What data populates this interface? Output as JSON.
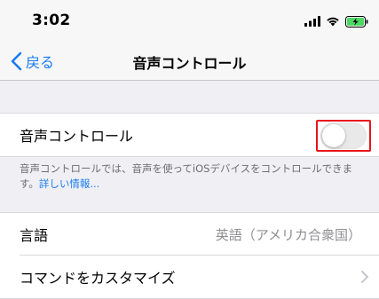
{
  "status": {
    "time": "3:02"
  },
  "nav": {
    "back_label": "戻る",
    "title": "音声コントロール"
  },
  "voice_control": {
    "label": "音声コントロール",
    "toggle_on": false,
    "footer_text": "音声コントロールでは、音声を使ってiOSデバイスをコントロールできます。",
    "footer_link": "詳しい情報..."
  },
  "settings": {
    "language_label": "言語",
    "language_value": "英語（アメリカ合衆国）",
    "customize_label": "コマンドをカスタマイズ"
  },
  "colors": {
    "accent": "#1a7cf2",
    "highlight": "#e8141b",
    "battery": "#4cd964"
  }
}
